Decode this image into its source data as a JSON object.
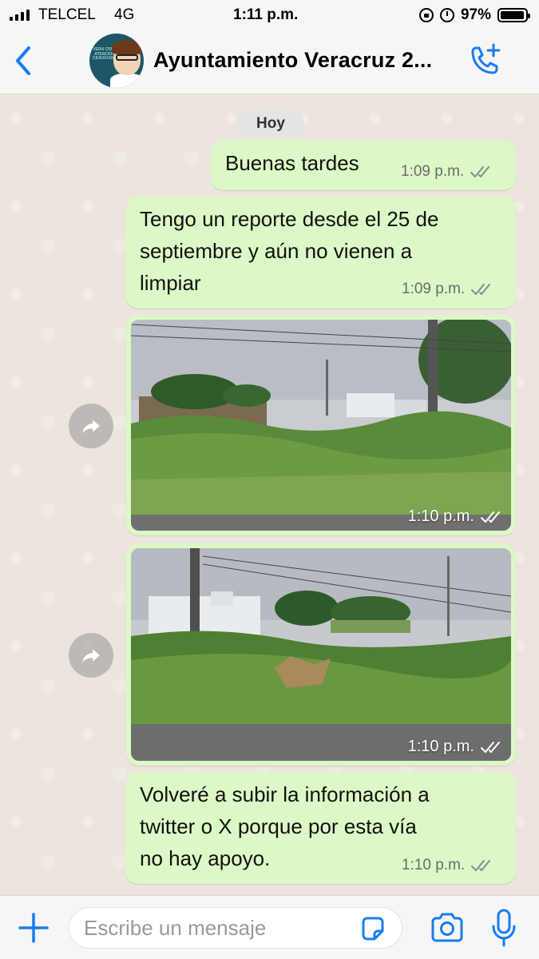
{
  "status_bar": {
    "carrier": "TELCEL",
    "network": "4G",
    "time": "1:11 p.m.",
    "battery": "97%",
    "battery_level": 0.97
  },
  "header": {
    "title": "Ayuntamiento Veracruz 2...",
    "back_icon": "chevron-left-icon",
    "call_icon": "add-call-icon",
    "avatar_text": "VERA CRUZ ATENCIÓN CIUDADANA"
  },
  "chat": {
    "date_label": "Hoy",
    "messages": [
      {
        "type": "text",
        "text": "Buenas tardes",
        "time": "1:09 p.m.",
        "status": "read"
      },
      {
        "type": "text",
        "lines": [
          "Tengo un reporte desde el 25 de",
          "septiembre y aún no vienen a",
          "limpiar"
        ],
        "time": "1:09 p.m.",
        "status": "read"
      },
      {
        "type": "image",
        "description": "vacant lot with overgrown weeds",
        "time": "1:10 p.m.",
        "status": "read"
      },
      {
        "type": "image",
        "description": "overgrown lot next to street",
        "time": "1:10 p.m.",
        "status": "read"
      },
      {
        "type": "text",
        "lines": [
          "Volveré a subir la información a",
          "twitter o X porque por esta vía",
          "no hay apoyo."
        ],
        "time": "1:10 p.m.",
        "status": "read"
      }
    ]
  },
  "input_bar": {
    "placeholder": "Escribe un mensaje",
    "icons": [
      "plus-icon",
      "sticker-icon",
      "camera-icon",
      "microphone-icon"
    ]
  },
  "colors": {
    "accent": "#1a7cf2",
    "bubble_outgoing": "#dcf8c6",
    "chat_background": "#ece5dd",
    "read_check": "#8a8a8a"
  }
}
